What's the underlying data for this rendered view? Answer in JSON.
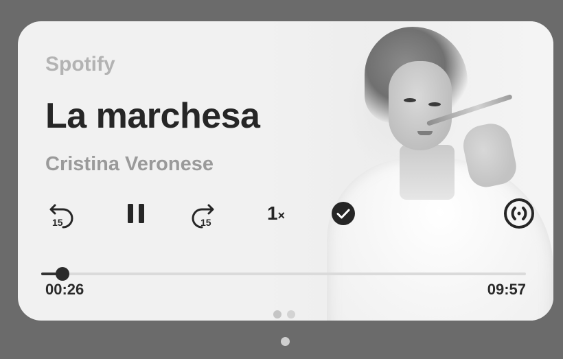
{
  "media": {
    "app_name": "Spotify",
    "track_title": "La marchesa",
    "artist": "Cristina Veronese",
    "elapsed": "00:26",
    "duration": "09:57",
    "progress_fraction": 0.044
  },
  "controls": {
    "rewind_label": "15",
    "forward_label": "15",
    "speed_value": "1",
    "speed_suffix": "×",
    "icons": [
      "rewind-15-icon",
      "pause-icon",
      "forward-15-icon",
      "speed-icon",
      "check-circle-icon",
      "cast-icon"
    ]
  },
  "pager": {
    "card_page_count": 2,
    "card_active_index": 0,
    "outer_page_count": 1
  },
  "colors": {
    "background": "#6b6b6b",
    "card": "#f1f1f1",
    "primary_text": "#262626",
    "secondary_text": "#9a9a9a",
    "app_name_text": "#b3b3b3"
  }
}
